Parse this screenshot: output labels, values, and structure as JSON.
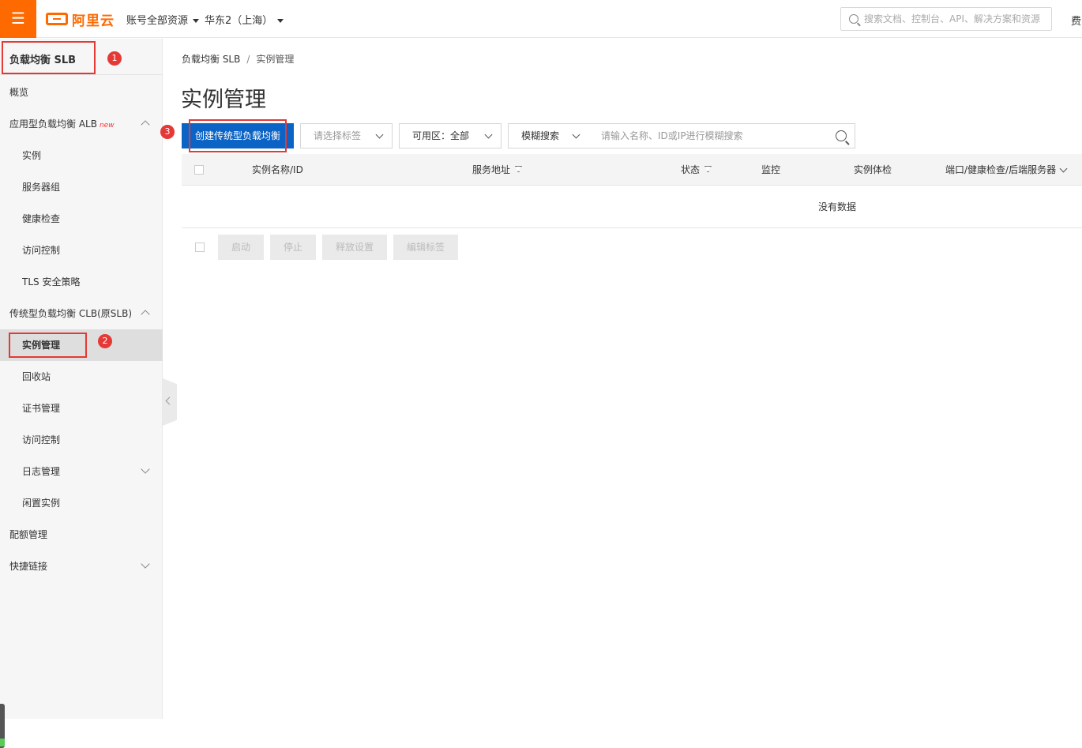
{
  "topbar": {
    "menu_icon": "hamburger-icon",
    "logo_text": "阿里云",
    "account_scope": "账号全部资源",
    "region": "华东2（上海）",
    "search_placeholder": "搜索文档、控制台、API、解决方案和资源",
    "user_initial": "费"
  },
  "sidebar": {
    "title": "负载均衡 SLB",
    "items": [
      {
        "label": "概览"
      },
      {
        "label": "应用型负载均衡 ALB",
        "badge": "new"
      },
      {
        "label": "实例"
      },
      {
        "label": "服务器组"
      },
      {
        "label": "健康检查"
      },
      {
        "label": "访问控制"
      },
      {
        "label": "TLS 安全策略"
      },
      {
        "label": "传统型负载均衡 CLB(原SLB)"
      },
      {
        "label": "实例管理"
      },
      {
        "label": "回收站"
      },
      {
        "label": "证书管理"
      },
      {
        "label": "访问控制"
      },
      {
        "label": "日志管理"
      },
      {
        "label": "闲置实例"
      },
      {
        "label": "配额管理"
      },
      {
        "label": "快捷链接"
      }
    ]
  },
  "annotations": [
    "1",
    "2",
    "3"
  ],
  "breadcrumb": {
    "root": "负载均衡 SLB",
    "separator": "/",
    "current": "实例管理"
  },
  "page_title": "实例管理",
  "toolbar": {
    "create_button": "创建传统型负载均衡",
    "tag_select_placeholder": "请选择标签",
    "zone_label": "可用区：",
    "zone_value": "全部",
    "search_mode": "模糊搜索",
    "search_placeholder": "请输入名称、ID或IP进行模糊搜索"
  },
  "table": {
    "columns": [
      "实例名称/ID",
      "服务地址",
      "状态",
      "监控",
      "实例体检",
      "端口/健康检查/后端服务器"
    ],
    "empty_text": "没有数据"
  },
  "batch_actions": {
    "start": "启动",
    "stop": "停止",
    "release": "释放设置",
    "edit_tags": "编辑标签"
  },
  "colors": {
    "brand_orange": "#ff6a00",
    "primary_blue": "#0b63c5",
    "annotation_red": "#e53935"
  }
}
